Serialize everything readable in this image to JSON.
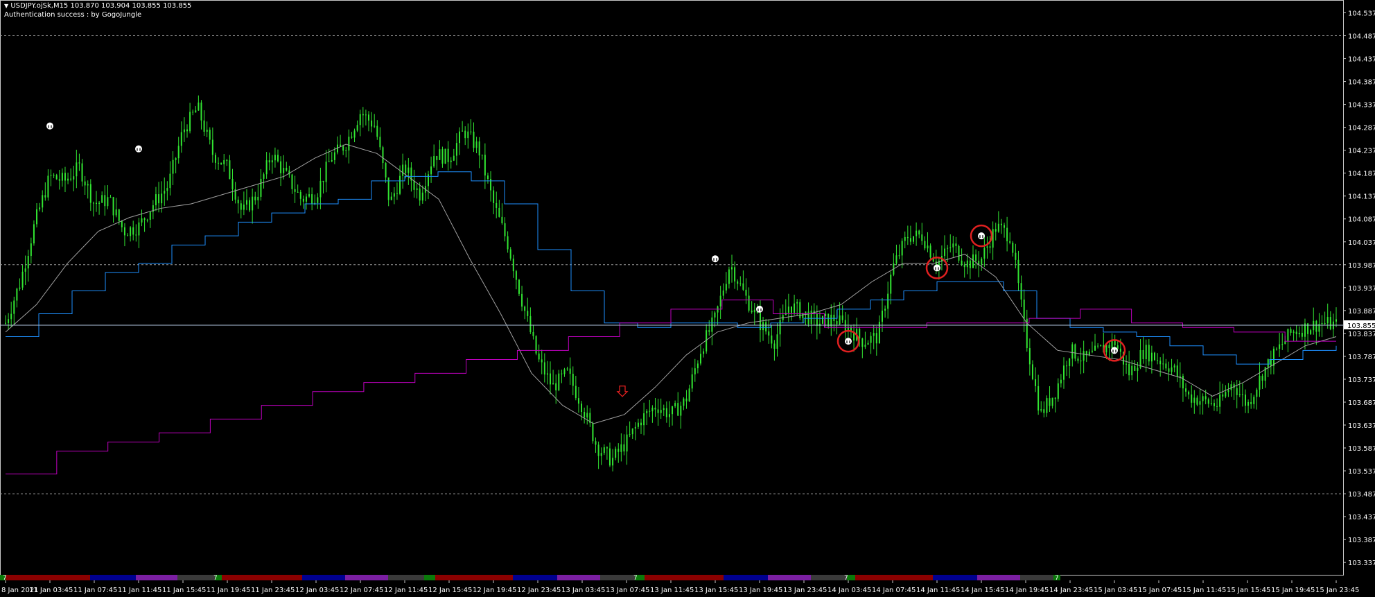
{
  "header": {
    "symbol_line": "USDJPY.ojSk,M15  103.870 103.904 103.855 103.855",
    "auth_text": "Authentication success : by GogoJungle",
    "collapse_icon": "triangle-down-icon"
  },
  "price_axis": {
    "ticks": [
      "104.537",
      "104.487",
      "104.437",
      "104.387",
      "104.337",
      "104.287",
      "104.237",
      "104.187",
      "104.137",
      "104.087",
      "104.037",
      "103.987",
      "103.937",
      "103.887",
      "103.837",
      "103.787",
      "103.737",
      "103.687",
      "103.637",
      "103.587",
      "103.537",
      "103.487",
      "103.437",
      "103.387",
      "103.337"
    ],
    "current_price": "103.855"
  },
  "time_axis": {
    "labels": [
      "8 Jan 2021",
      "11 Jan 03:45",
      "11 Jan 07:45",
      "11 Jan 11:45",
      "11 Jan 15:45",
      "11 Jan 19:45",
      "11 Jan 23:45",
      "12 Jan 03:45",
      "12 Jan 07:45",
      "12 Jan 11:45",
      "12 Jan 15:45",
      "12 Jan 19:45",
      "12 Jan 23:45",
      "13 Jan 03:45",
      "13 Jan 07:45",
      "13 Jan 11:45",
      "13 Jan 15:45",
      "13 Jan 19:45",
      "13 Jan 23:45",
      "14 Jan 03:45",
      "14 Jan 07:45",
      "14 Jan 11:45",
      "14 Jan 15:45",
      "14 Jan 19:45",
      "14 Jan 23:45",
      "15 Jan 03:45",
      "15 Jan 07:45",
      "15 Jan 11:45",
      "15 Jan 15:45",
      "15 Jan 19:45",
      "15 Jan 23:45"
    ]
  },
  "session_bar": {
    "marker_text": "7",
    "colors": {
      "red": "#8b0000",
      "blue": "#000090",
      "purple": "#7b1fa2",
      "gray": "#3a3a3a",
      "green": "#0a7a0a"
    }
  },
  "colors": {
    "candles": "#32e632",
    "ma_fast": "#a0a0a0",
    "ma_blue": "#1e90ff",
    "ma_magenta": "#c000c0",
    "current_line": "#b0c4de",
    "signal_circle": "#e02020",
    "arrow_red": "#e02020",
    "arrow_yellow": "#e0c000"
  },
  "chart_data": {
    "type": "line",
    "instrument": "USDJPY.ojSk",
    "timeframe": "M15",
    "ohlc_last": {
      "open": 103.87,
      "high": 103.904,
      "low": 103.855,
      "close": 103.855
    },
    "ylim": [
      103.31,
      104.565
    ],
    "x_categories": [
      "8 Jan 2021",
      "11 Jan 03:45",
      "11 Jan 07:45",
      "11 Jan 11:45",
      "11 Jan 15:45",
      "11 Jan 19:45",
      "11 Jan 23:45",
      "12 Jan 03:45",
      "12 Jan 07:45",
      "12 Jan 11:45",
      "12 Jan 15:45",
      "12 Jan 19:45",
      "12 Jan 23:45",
      "13 Jan 03:45",
      "13 Jan 07:45",
      "13 Jan 11:45",
      "13 Jan 15:45",
      "13 Jan 19:45",
      "13 Jan 23:45",
      "14 Jan 03:45",
      "14 Jan 07:45",
      "14 Jan 11:45",
      "14 Jan 15:45",
      "14 Jan 19:45",
      "14 Jan 23:45",
      "15 Jan 03:45",
      "15 Jan 07:45",
      "15 Jan 11:45",
      "15 Jan 15:45",
      "15 Jan 19:45",
      "15 Jan 23:45"
    ],
    "reference_levels": [
      104.487,
      103.987,
      103.487
    ],
    "series": [
      {
        "values": [
          103.86,
          103.95,
          104.08,
          104.18,
          104.17,
          104.2,
          104.12,
          104.13,
          104.06,
          104.07,
          104.12,
          104.16,
          104.28,
          104.33,
          104.23,
          104.2,
          104.1,
          104.14,
          104.23,
          104.18,
          104.13,
          104.14,
          104.22,
          104.25,
          104.32,
          104.29,
          104.12,
          104.2,
          104.14,
          104.23,
          104.22,
          104.28,
          104.24,
          104.12,
          104.03,
          103.9,
          103.78,
          103.72,
          103.75,
          103.68,
          103.59,
          103.56,
          103.6,
          103.65,
          103.68,
          103.66,
          103.69,
          103.8,
          103.87,
          103.99,
          103.92,
          103.86,
          103.82,
          103.9,
          103.88,
          103.86,
          103.87,
          103.85,
          103.82,
          103.83,
          103.98,
          104.05,
          104.05,
          103.99,
          104.03,
          103.99,
          104.0,
          104.07,
          104.05,
          103.83,
          103.66,
          103.71,
          103.8,
          103.78,
          103.8,
          103.82,
          103.75,
          103.8,
          103.78,
          103.76,
          103.7,
          103.69,
          103.68,
          103.73,
          103.68,
          103.75,
          103.8,
          103.84,
          103.85,
          103.86,
          103.855
        ]
      },
      {
        "values": [
          103.84,
          103.9,
          103.99,
          104.06,
          104.09,
          104.11,
          104.12,
          104.14,
          104.16,
          104.18,
          104.22,
          104.25,
          104.23,
          104.18,
          104.13,
          104.0,
          103.88,
          103.75,
          103.68,
          103.64,
          103.66,
          103.72,
          103.79,
          103.84,
          103.86,
          103.87,
          103.88,
          103.9,
          103.95,
          103.99,
          103.99,
          104.01,
          103.96,
          103.86,
          103.8,
          103.79,
          103.78,
          103.76,
          103.74,
          103.7,
          103.73,
          103.77,
          103.81,
          103.83
        ]
      },
      {
        "values": [
          103.83,
          103.88,
          103.93,
          103.97,
          103.99,
          104.03,
          104.05,
          104.08,
          104.1,
          104.12,
          104.13,
          104.17,
          104.18,
          104.19,
          104.17,
          104.12,
          104.02,
          103.93,
          103.86,
          103.85,
          103.86,
          103.86,
          103.85,
          103.86,
          103.87,
          103.89,
          103.91,
          103.93,
          103.95,
          103.95,
          103.93,
          103.87,
          103.85,
          103.84,
          103.83,
          103.81,
          103.79,
          103.77,
          103.78,
          103.8,
          103.81
        ]
      },
      {
        "values": [
          103.53,
          103.58,
          103.6,
          103.62,
          103.65,
          103.68,
          103.71,
          103.73,
          103.75,
          103.78,
          103.8,
          103.83,
          103.86,
          103.89,
          103.91,
          103.88,
          103.85,
          103.85,
          103.86,
          103.86,
          103.87,
          103.89,
          103.86,
          103.85,
          103.84,
          103.82,
          103.82
        ]
      }
    ],
    "signal_markers": [
      {
        "time": "11 Jan 03:45",
        "price": 104.29
      },
      {
        "time": "11 Jan 11:45",
        "price": 104.24
      },
      {
        "time": "13 Jan 15:45",
        "price": 104.0
      },
      {
        "time": "13 Jan 19:45",
        "price": 103.89
      },
      {
        "time": "14 Jan 03:45",
        "price": 103.82,
        "circled": true
      },
      {
        "time": "14 Jan 11:45",
        "price": 103.98,
        "circled": true
      },
      {
        "time": "14 Jan 15:45",
        "price": 104.05,
        "circled": true
      },
      {
        "time": "15 Jan 03:45",
        "price": 103.8,
        "circled": true
      }
    ]
  }
}
